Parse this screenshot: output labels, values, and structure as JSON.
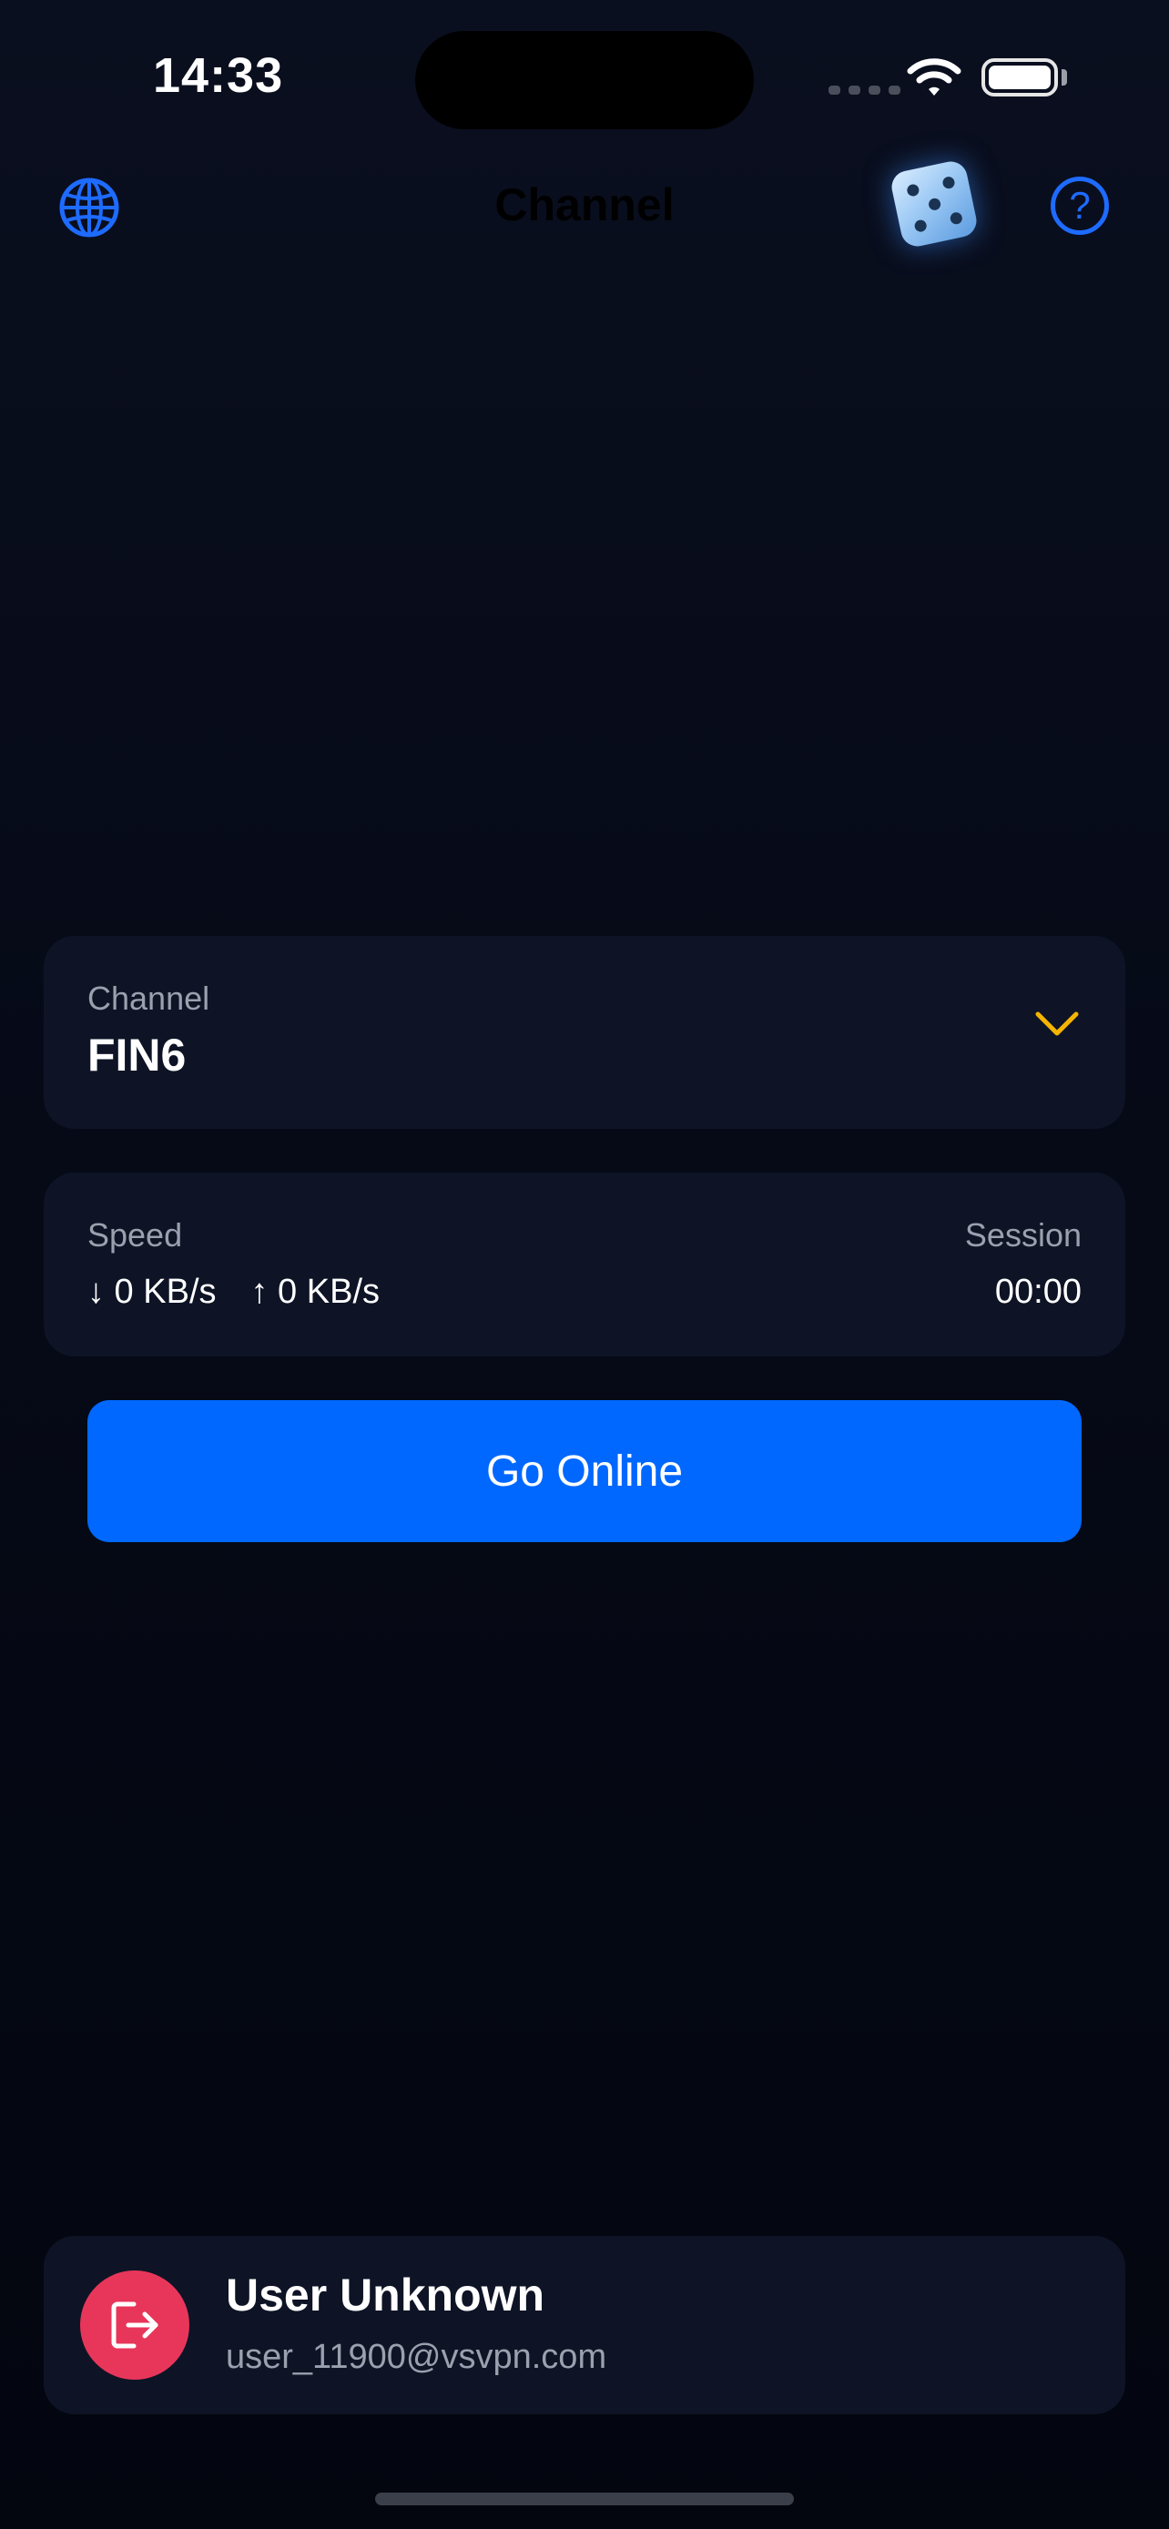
{
  "status_bar": {
    "time": "14:33"
  },
  "nav": {
    "title": "Channel",
    "left_icon": "globe-icon",
    "right_icons": [
      "dice-icon",
      "help-icon"
    ],
    "help_glyph": "?"
  },
  "channel": {
    "label": "Channel",
    "value": "FIN6",
    "accent": "#f5b400"
  },
  "stats": {
    "speed_label": "Speed",
    "download": "↓ 0 KB/s",
    "upload": "↑ 0 KB/s",
    "session_label": "Session",
    "session_value": "00:00"
  },
  "connect_button": {
    "label": "Go Online",
    "color": "#0068ff"
  },
  "user": {
    "name": "User Unknown",
    "email": "user_11900@vsvpn.com",
    "logout_icon": "logout-icon",
    "logout_color": "#e8365a"
  }
}
